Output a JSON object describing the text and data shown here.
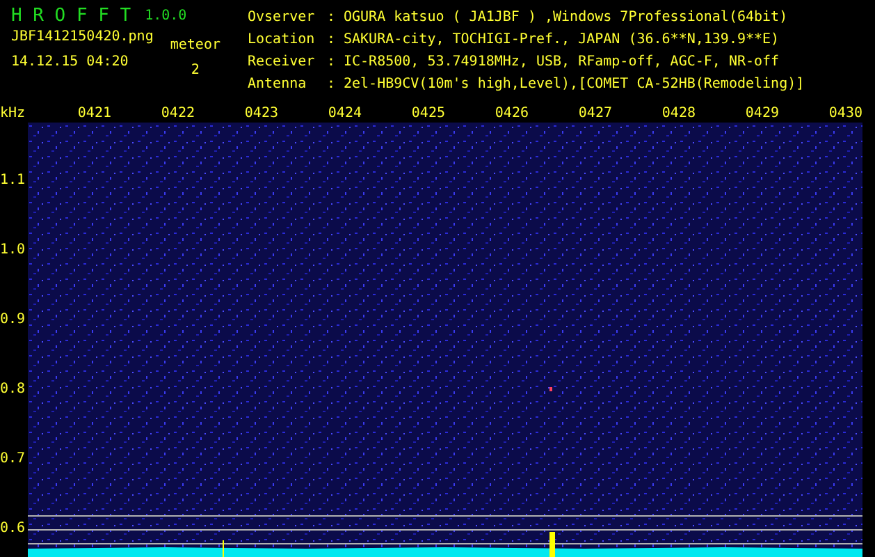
{
  "app": {
    "name": "H R O F F T",
    "version": "1.0.0",
    "file": "JBF1412150420.png",
    "timestamp": "14.12.15 04:20",
    "count_label": "meteor",
    "count": "2"
  },
  "info": [
    {
      "label": "Ovserver",
      "separator": ":",
      "value": "OGURA katsuo ( JA1JBF ) ,Windows 7Professional(64bit)"
    },
    {
      "label": "Location",
      "separator": ":",
      "value": "SAKURA-city, TOCHIGI-Pref., JAPAN (36.6**N,139.9**E)"
    },
    {
      "label": "Receiver",
      "separator": ":",
      "value": "IC-R8500, 53.74918MHz, USB, RFamp-off, AGC-F, NR-off"
    },
    {
      "label": "Antenna",
      "separator": ":",
      "value": "2el-HB9CV(10m's high,Level),[COMET CA-52HB(Remodeling)]"
    }
  ],
  "spectrogram": {
    "unit": "kHz",
    "time_labels": [
      "0421",
      "0422",
      "0423",
      "0424",
      "0425",
      "0426",
      "0427",
      "0428",
      "0429",
      "0430"
    ],
    "freq_labels": [
      "1.1",
      "1.0",
      "0.9",
      "0.8",
      "0.7",
      "0.6"
    ]
  }
}
